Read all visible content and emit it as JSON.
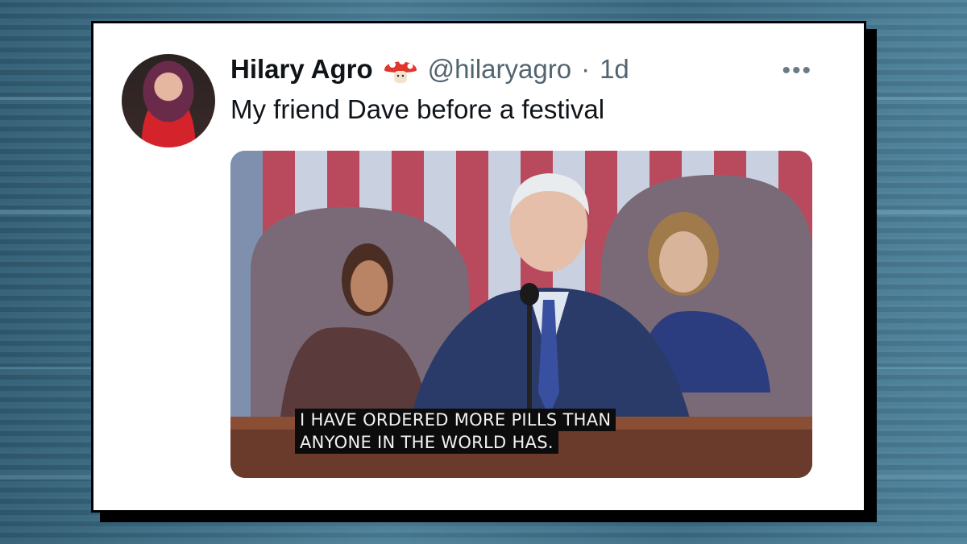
{
  "tweet": {
    "display_name": "Hilary Agro",
    "handle": "@hilaryagro",
    "separator": "·",
    "timestamp": "1d",
    "name_emoji": "mushroom-icon",
    "text": "My friend Dave before a festival",
    "more_label": "•••"
  },
  "media": {
    "caption_line1": "I HAVE ORDERED MORE PILLS THAN",
    "caption_line2": "ANYONE IN THE WORLD HAS."
  },
  "colors": {
    "background": "#3f6f86",
    "card": "#ffffff",
    "text_primary": "#0f1419",
    "text_secondary": "#536471"
  }
}
